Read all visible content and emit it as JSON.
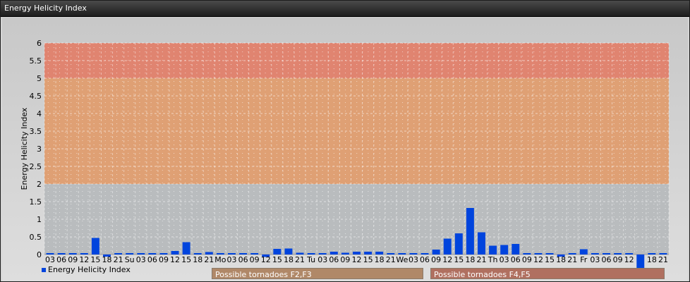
{
  "window": {
    "title": "Energy Helicity Index"
  },
  "legend": {
    "label": "Energy Helicity Index",
    "color": "#0044dd"
  },
  "bands": [
    {
      "label": "Possible tornadoes F2,F3",
      "color": "#b08868"
    },
    {
      "label": "Possible tornadoes F4,F5",
      "color": "#b07060"
    }
  ],
  "chart_data": {
    "type": "bar",
    "ylabel": "Energy Helicity Index",
    "ylim": [
      0,
      6
    ],
    "yticks": [
      "0",
      "0.5",
      "1",
      "1.5",
      "2",
      "2.5",
      "3",
      "3.5",
      "4",
      "4.5",
      "5",
      "5.5",
      "6"
    ],
    "zones": [
      {
        "from": 0,
        "to": 2,
        "color": "#b9bcbe"
      },
      {
        "from": 2,
        "to": 5,
        "color": "#dfa074"
      },
      {
        "from": 5,
        "to": 6,
        "color": "#e08470"
      }
    ],
    "categories": [
      "03",
      "06",
      "09",
      "12",
      "15",
      "18",
      "21",
      "Su",
      "03",
      "06",
      "09",
      "12",
      "15",
      "18",
      "21",
      "Mo",
      "03",
      "06",
      "09",
      "12",
      "15",
      "18",
      "21",
      "Tu",
      "03",
      "06",
      "09",
      "12",
      "15",
      "18",
      "21",
      "We",
      "03",
      "06",
      "09",
      "12",
      "15",
      "18",
      "21",
      "Th",
      "03",
      "06",
      "09",
      "12",
      "15",
      "18",
      "21",
      "Fr",
      "03",
      "06",
      "09",
      "12",
      "",
      "18",
      "21"
    ],
    "color": "#0044dd",
    "values": [
      0.02,
      0.02,
      0.02,
      0.02,
      0.47,
      -0.06,
      0.02,
      0.02,
      0.02,
      0.02,
      0.02,
      0.1,
      0.35,
      0.02,
      0.07,
      0.02,
      0.02,
      0.03,
      0.02,
      -0.07,
      0.16,
      0.17,
      0.05,
      0.02,
      0.04,
      0.08,
      0.05,
      0.08,
      0.08,
      0.08,
      0.02,
      0.02,
      0.02,
      0.02,
      0.14,
      0.45,
      0.6,
      1.32,
      0.63,
      0.25,
      0.27,
      0.3,
      0.04,
      0.04,
      0.02,
      -0.06,
      0.02,
      0.15,
      0.03,
      0.02,
      0.03,
      0.02,
      -0.45,
      0.02,
      0.02
    ]
  }
}
